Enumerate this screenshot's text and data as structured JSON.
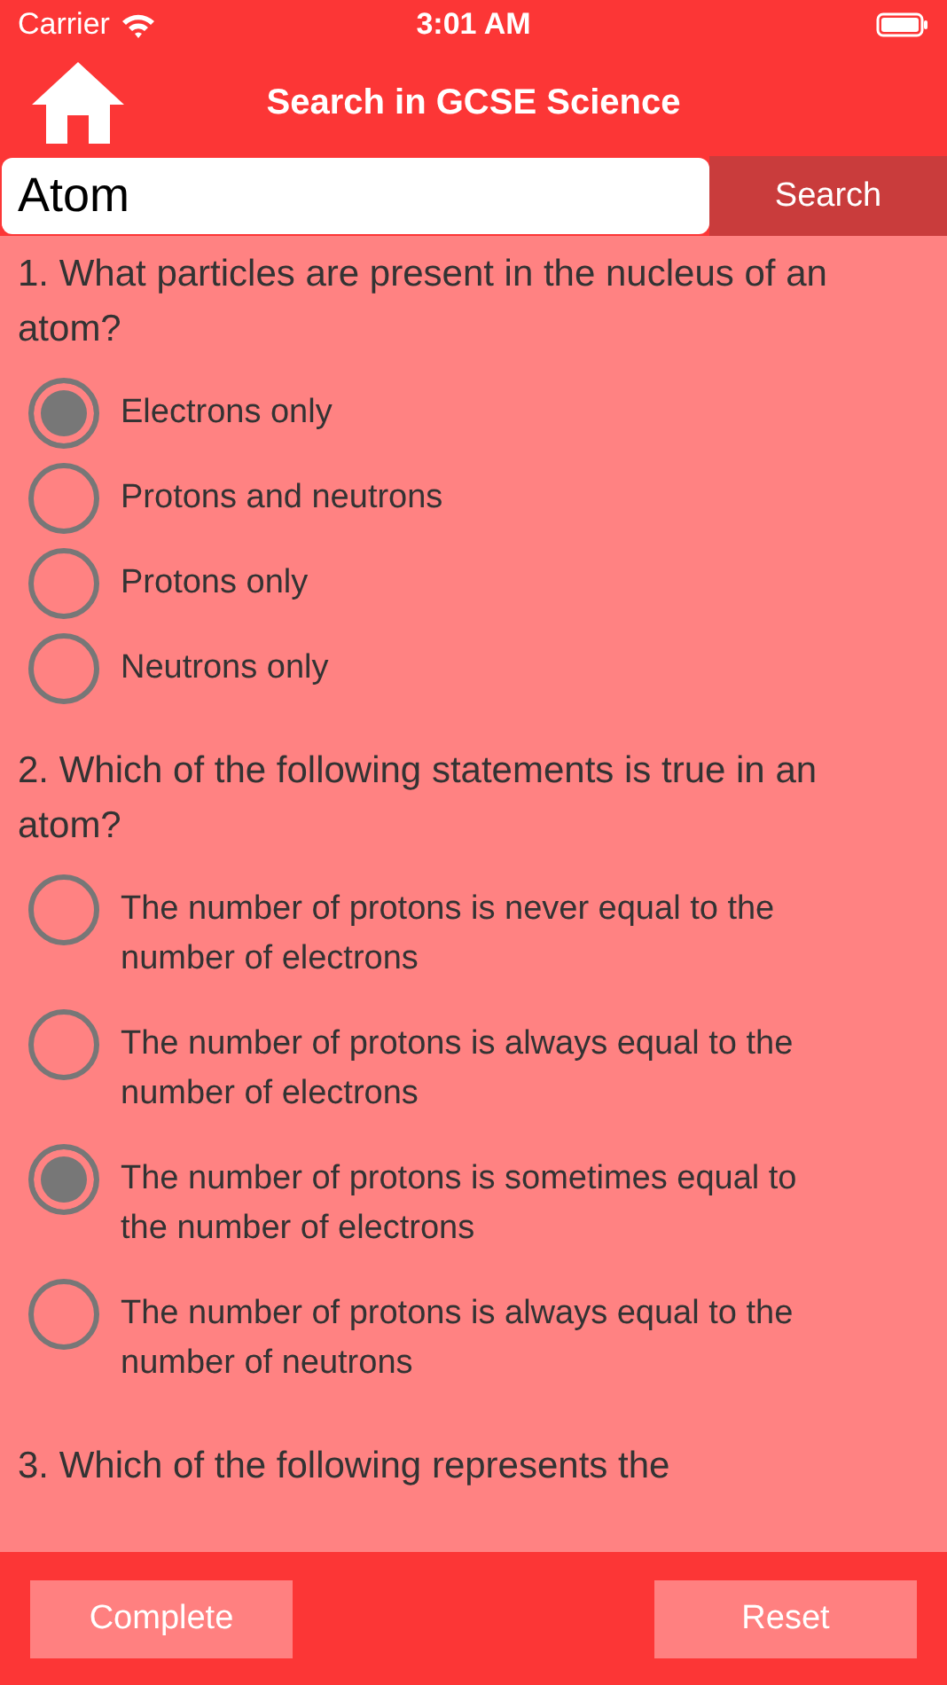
{
  "status_bar": {
    "carrier": "Carrier",
    "time": "3:01 AM"
  },
  "header": {
    "title": "Search in GCSE Science"
  },
  "search": {
    "value": "Atom",
    "button": "Search"
  },
  "questions": [
    {
      "text": "1. What particles are present in the nucleus of an atom?",
      "options": [
        {
          "label": "Electrons only",
          "selected": true
        },
        {
          "label": "Protons and neutrons",
          "selected": false
        },
        {
          "label": "Protons only",
          "selected": false
        },
        {
          "label": "Neutrons only",
          "selected": false
        }
      ]
    },
    {
      "text": "2. Which of the following statements is true in an atom?",
      "options": [
        {
          "label": "The number of protons is never equal to the number of electrons",
          "selected": false
        },
        {
          "label": "The number of protons is always equal to the number of electrons",
          "selected": false
        },
        {
          "label": "The number of protons is sometimes equal to the number of electrons",
          "selected": true
        },
        {
          "label": "The number of protons is always equal to the number of neutrons",
          "selected": false
        }
      ]
    },
    {
      "text": "3. Which of the following represents the"
    }
  ],
  "footer": {
    "buttons": [
      "Complete",
      "Reset"
    ]
  }
}
